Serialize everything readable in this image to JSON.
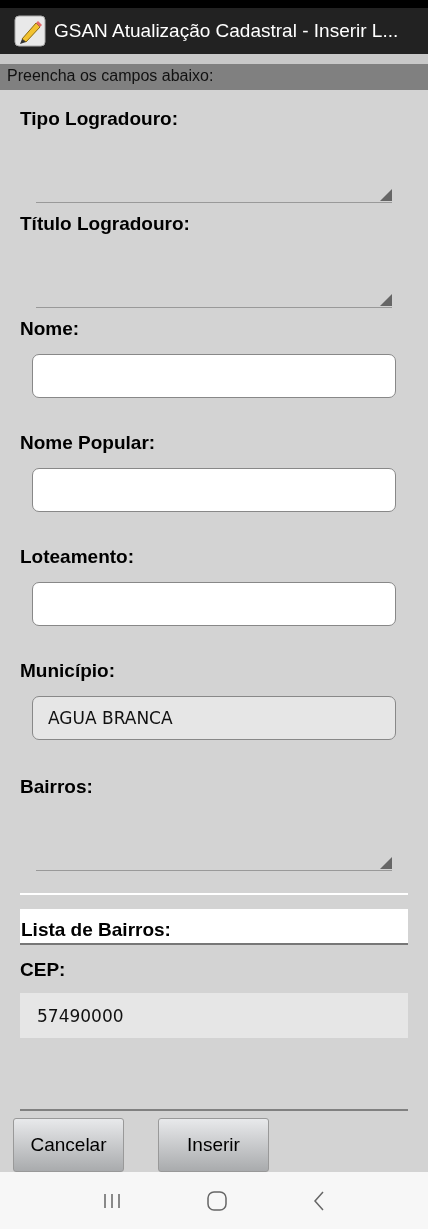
{
  "window": {
    "title": "GSAN Atualização Cadastral - Inserir L..."
  },
  "header": "Preencha os campos abaixo:",
  "fields": [
    {
      "kind": "spinner",
      "label": "Tipo Logradouro:"
    },
    {
      "kind": "spinner",
      "label": "Título Logradouro:"
    },
    {
      "kind": "input",
      "label": "Nome:"
    },
    {
      "kind": "input",
      "label": "Nome Popular:"
    },
    {
      "kind": "input",
      "label": "Loteamento:"
    },
    {
      "kind": "readonly",
      "label": "Município:",
      "value": "AGUA BRANCA"
    },
    {
      "kind": "spinner",
      "label": "Bairros:"
    },
    {
      "kind": "list",
      "label": "Lista de Bairros:"
    },
    {
      "kind": "plain",
      "label": "CEP:",
      "value": "57490000"
    }
  ],
  "buttons": [
    "Cancelar",
    "Inserir"
  ]
}
